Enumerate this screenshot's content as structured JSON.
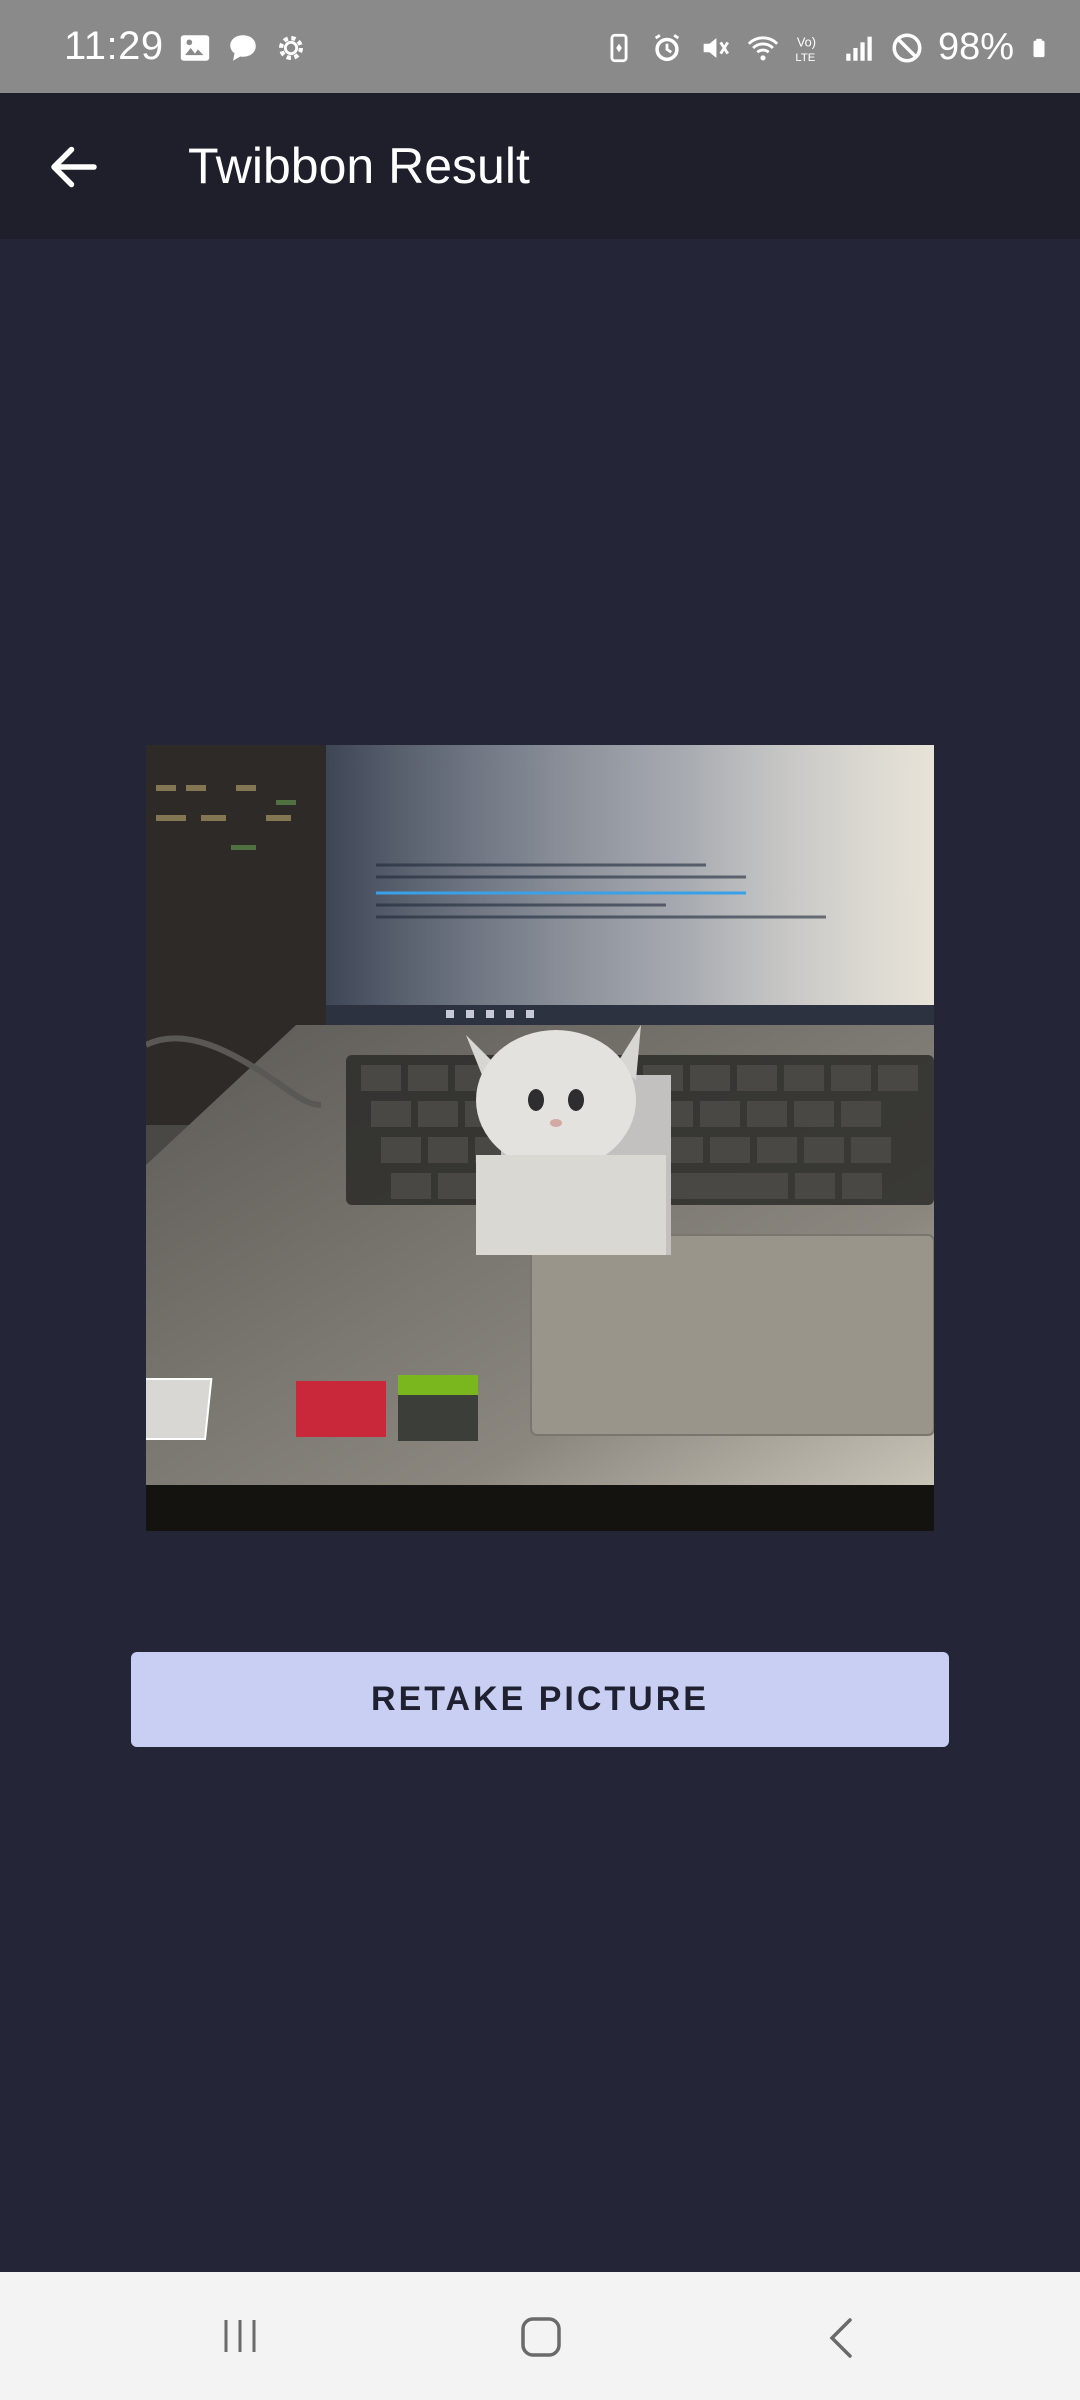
{
  "status_bar": {
    "time": "11:29",
    "battery_text": "98%",
    "left_icons": [
      "gallery-icon",
      "chat-bubble-icon",
      "settings-icon"
    ],
    "right_icons": [
      "battery-saver-icon",
      "alarm-icon",
      "mute-icon",
      "wifi-icon",
      "volte-icon",
      "signal-icon",
      "do-not-disturb-icon",
      "battery-icon"
    ]
  },
  "app_bar": {
    "title": "Twibbon Result",
    "back_icon": "arrow-back-icon"
  },
  "content": {
    "image_description": "photo-laptop-with-cat-overlay",
    "retake_label": "RETAKE PICTURE"
  },
  "nav_bar": {
    "items": [
      "recents-icon",
      "home-icon",
      "back-icon"
    ]
  },
  "colors": {
    "background": "#252538",
    "app_bar": "#1f1f2c",
    "status_bar": "#8a8a8a",
    "button": "#c9cff2",
    "nav_bar": "#f3f3f3"
  }
}
